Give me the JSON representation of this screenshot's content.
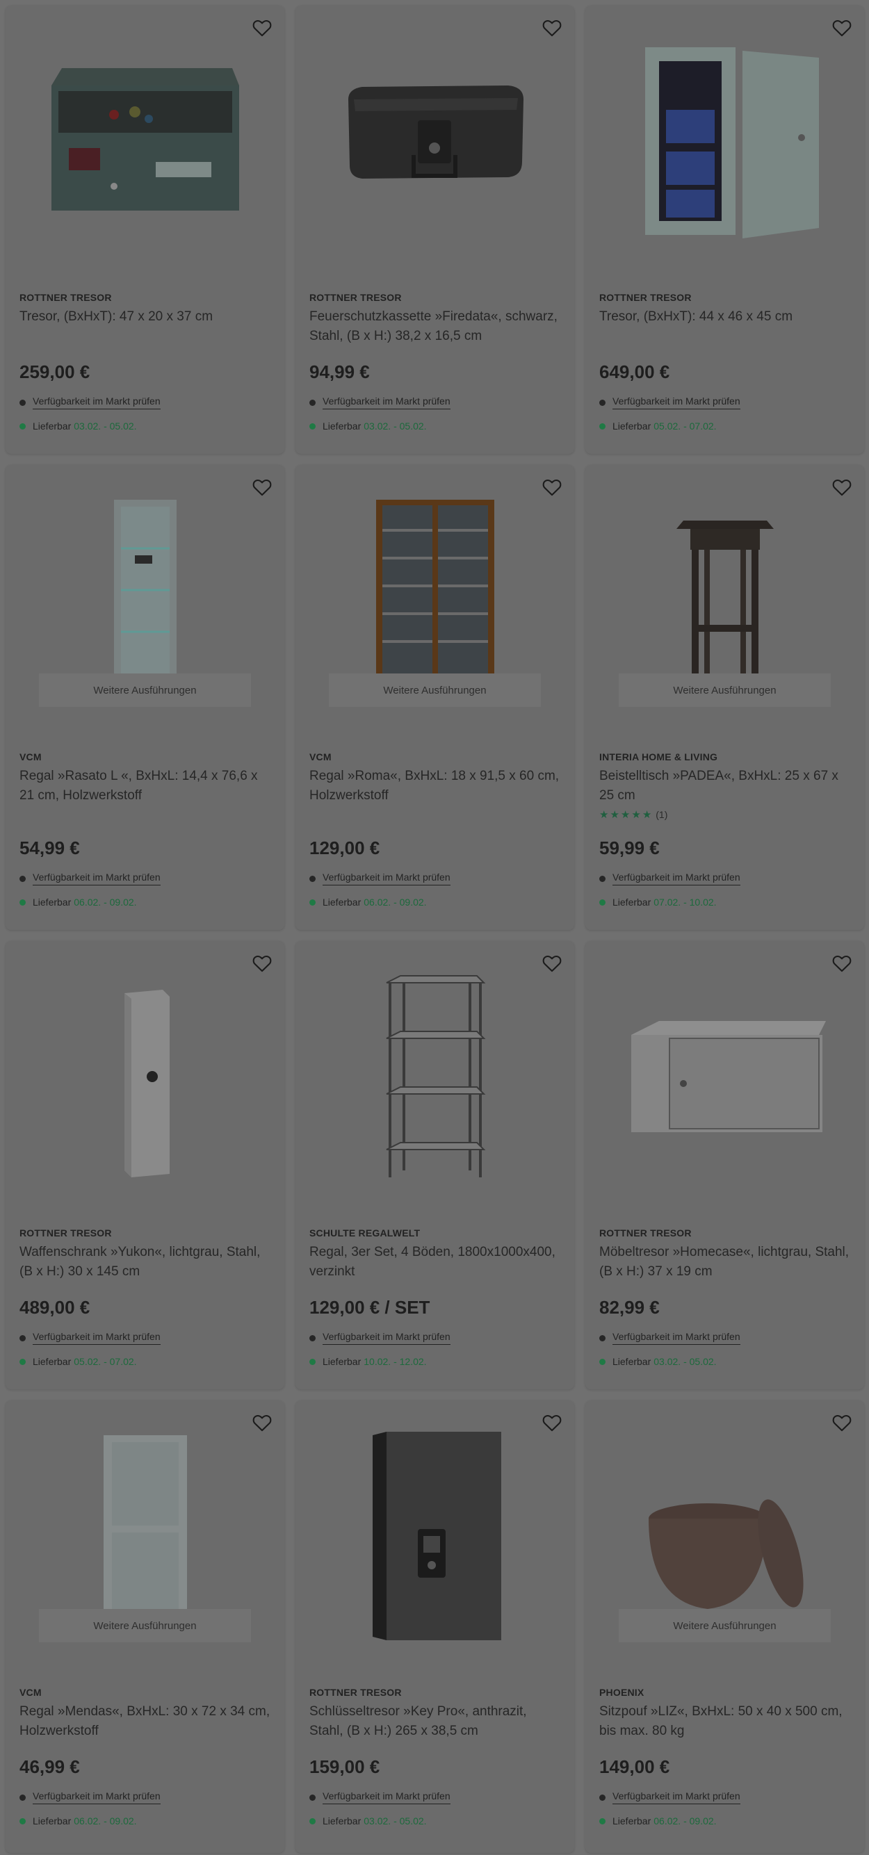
{
  "products": [
    {
      "brand": "ROTTNER TRESOR",
      "title": "Tresor, (BxHxT): 47 x 20 x 37 cm",
      "price": "259,00 €",
      "availability": "Verfügbarkeit im Markt prüfen",
      "delivery_label": "Lieferbar",
      "delivery_dates": "03.02. - 05.02.",
      "image": "drawer-safe"
    },
    {
      "brand": "ROTTNER TRESOR",
      "title": "Feuerschutzkassette »Firedata«, schwarz, Stahl, (B x H:) 38,2 x 16,5 cm",
      "price": "94,99 €",
      "availability": "Verfügbarkeit im Markt prüfen",
      "delivery_label": "Lieferbar",
      "delivery_dates": "03.02. - 05.02.",
      "image": "fire-box"
    },
    {
      "brand": "ROTTNER TRESOR",
      "title": "Tresor, (BxHxT): 44 x 46 x 45 cm",
      "price": "649,00 €",
      "availability": "Verfügbarkeit im Markt prüfen",
      "delivery_label": "Lieferbar",
      "delivery_dates": "05.02. - 07.02.",
      "image": "open-safe"
    },
    {
      "brand": "VCM",
      "title": "Regal »Rasato L «, BxHxL: 14,4 x 76,6 x 21 cm, Holzwerkstoff",
      "price": "54,99 €",
      "availability": "Verfügbarkeit im Markt prüfen",
      "delivery_label": "Lieferbar",
      "delivery_dates": "06.02. - 09.02.",
      "more_label": "Weitere Ausführungen",
      "image": "glass-shelf"
    },
    {
      "brand": "VCM",
      "title": "Regal »Roma«, BxHxL: 18 x 91,5 x 60 cm, Holzwerkstoff",
      "price": "129,00 €",
      "availability": "Verfügbarkeit im Markt prüfen",
      "delivery_label": "Lieferbar",
      "delivery_dates": "06.02. - 09.02.",
      "more_label": "Weitere Ausführungen",
      "image": "cd-shelf"
    },
    {
      "brand": "INTERIA HOME & LIVING",
      "title": "Beistelltisch »PADEA«, BxHxL: 25 x 67 x 25 cm",
      "rating_count": "(1)",
      "price": "59,99 €",
      "availability": "Verfügbarkeit im Markt prüfen",
      "delivery_label": "Lieferbar",
      "delivery_dates": "07.02. - 10.02.",
      "more_label": "Weitere Ausführungen",
      "image": "side-table"
    },
    {
      "brand": "ROTTNER TRESOR",
      "title": "Waffenschrank »Yukon«, lichtgrau, Stahl, (B x H:) 30 x 145 cm",
      "price": "489,00 €",
      "availability": "Verfügbarkeit im Markt prüfen",
      "delivery_label": "Lieferbar",
      "delivery_dates": "05.02. - 07.02.",
      "image": "gun-cabinet"
    },
    {
      "brand": "SCHULTE REGALWELT",
      "title": "Regal, 3er Set, 4 Böden, 1800x1000x400, verzinkt",
      "price": "129,00 € / SET",
      "availability": "Verfügbarkeit im Markt prüfen",
      "delivery_label": "Lieferbar",
      "delivery_dates": "10.02. - 12.02.",
      "image": "metal-rack"
    },
    {
      "brand": "ROTTNER TRESOR",
      "title": "Möbeltresor »Homecase«, lichtgrau, Stahl, (B x H:) 37 x 19 cm",
      "price": "82,99 €",
      "availability": "Verfügbarkeit im Markt prüfen",
      "delivery_label": "Lieferbar",
      "delivery_dates": "03.02. - 05.02.",
      "image": "furniture-safe"
    },
    {
      "brand": "VCM",
      "title": "Regal »Mendas«, BxHxL: 30 x 72 x 34 cm, Holzwerkstoff",
      "price": "46,99 €",
      "availability": "Verfügbarkeit im Markt prüfen",
      "delivery_label": "Lieferbar",
      "delivery_dates": "06.02. - 09.02.",
      "more_label": "Weitere Ausführungen",
      "image": "white-shelf"
    },
    {
      "brand": "ROTTNER TRESOR",
      "title": "Schlüsseltresor »Key Pro«, anthrazit, Stahl, (B x H:) 265 x 38,5 cm",
      "price": "159,00 €",
      "availability": "Verfügbarkeit im Markt prüfen",
      "delivery_label": "Lieferbar",
      "delivery_dates": "03.02. - 05.02.",
      "image": "key-safe"
    },
    {
      "brand": "PHOENIX",
      "title": "Sitzpouf »LIZ«, BxHxL: 50 x 40 x 500 cm, bis max. 80 kg",
      "price": "149,00 €",
      "availability": "Verfügbarkeit im Markt prüfen",
      "delivery_label": "Lieferbar",
      "delivery_dates": "06.02. - 09.02.",
      "more_label": "Weitere Ausführungen",
      "image": "stone-pouf"
    }
  ],
  "colors": {
    "overlay": "#707070",
    "card": "#6b6b6b",
    "delivery_green": "#1f7a45"
  },
  "icons": {
    "wishlist": "heart-outline-icon",
    "rating": "star-icon"
  }
}
